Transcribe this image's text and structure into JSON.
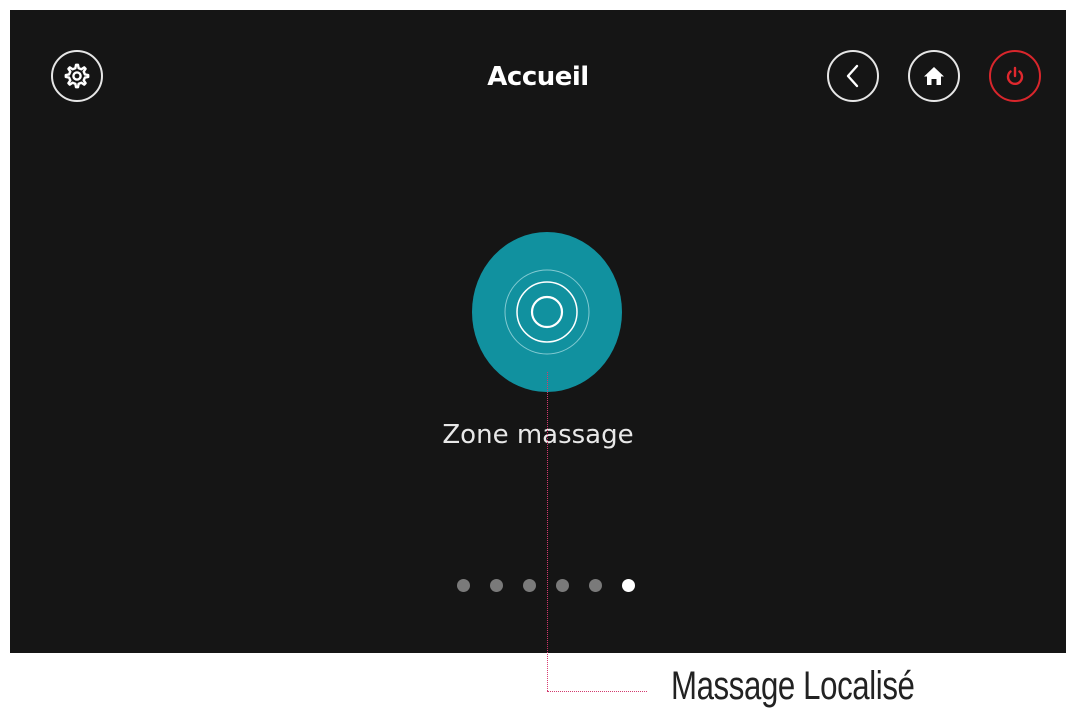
{
  "header": {
    "title": "Accueil",
    "icons": {
      "settings": "gear-icon",
      "back": "chevron-left-icon",
      "home": "home-icon",
      "power": "power-icon"
    }
  },
  "main": {
    "zone_button_label": "Zone massage",
    "zone_icon": "target-icon"
  },
  "pagination": {
    "total": 6,
    "active_index": 5
  },
  "annotation": {
    "text": "Massage Localisé"
  },
  "colors": {
    "background": "#151515",
    "accent": "#11919f",
    "power": "#d9262c",
    "callout": "#d33a6e"
  }
}
